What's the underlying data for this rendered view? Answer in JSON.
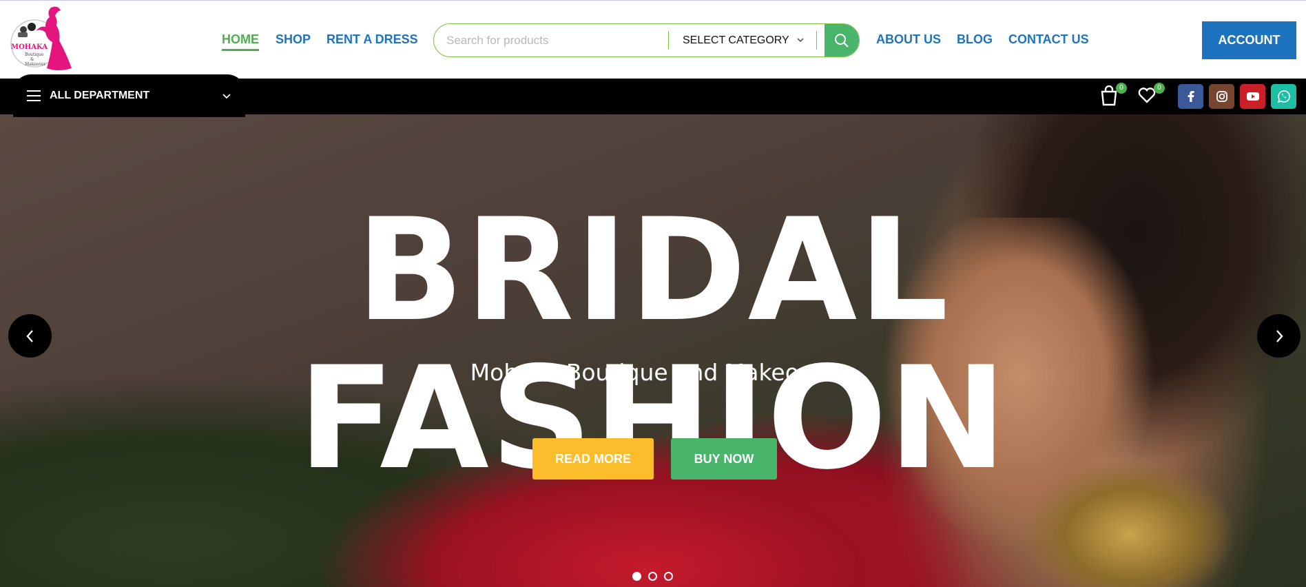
{
  "brand": {
    "name": "MOHAKA",
    "tagline_line1": "Boutique",
    "tagline_line2": "&",
    "tagline_line3": "Makeover",
    "colors": {
      "logo_pink": "#e4157c"
    }
  },
  "nav": {
    "home": "HOME",
    "shop": "SHOP",
    "rent": "RENT A DRESS",
    "about": "ABOUT US",
    "blog": "BLOG",
    "contact": "CONTACT US",
    "active": "HOME"
  },
  "search": {
    "placeholder": "Search for products",
    "category": "SELECT CATEGORY",
    "icon": "search-icon"
  },
  "account": {
    "label": "ACCOUNT"
  },
  "departments": {
    "label": "ALL DEPARTMENT"
  },
  "cart": {
    "count": "0",
    "icon": "shopping-bag-icon"
  },
  "wishlist": {
    "count": "0",
    "icon": "heart-icon"
  },
  "social": [
    {
      "icon": "facebook-icon",
      "color": "#3b5998"
    },
    {
      "icon": "instagram-icon",
      "color": "#774430"
    },
    {
      "icon": "youtube-icon",
      "color": "#cb2027"
    },
    {
      "icon": "whatsapp-icon",
      "color": "#1ebea5"
    }
  ],
  "hero": {
    "title": "BRIDAL FASHION",
    "subtitle": "Mohaka Boutique and Makeover",
    "read_more": "READ MORE",
    "buy_now": "BUY NOW",
    "slides": 3,
    "active_slide": 1
  },
  "colors": {
    "primary_blue": "#1e73be",
    "green": "#48b56a",
    "yellow": "#fbbd2c"
  }
}
